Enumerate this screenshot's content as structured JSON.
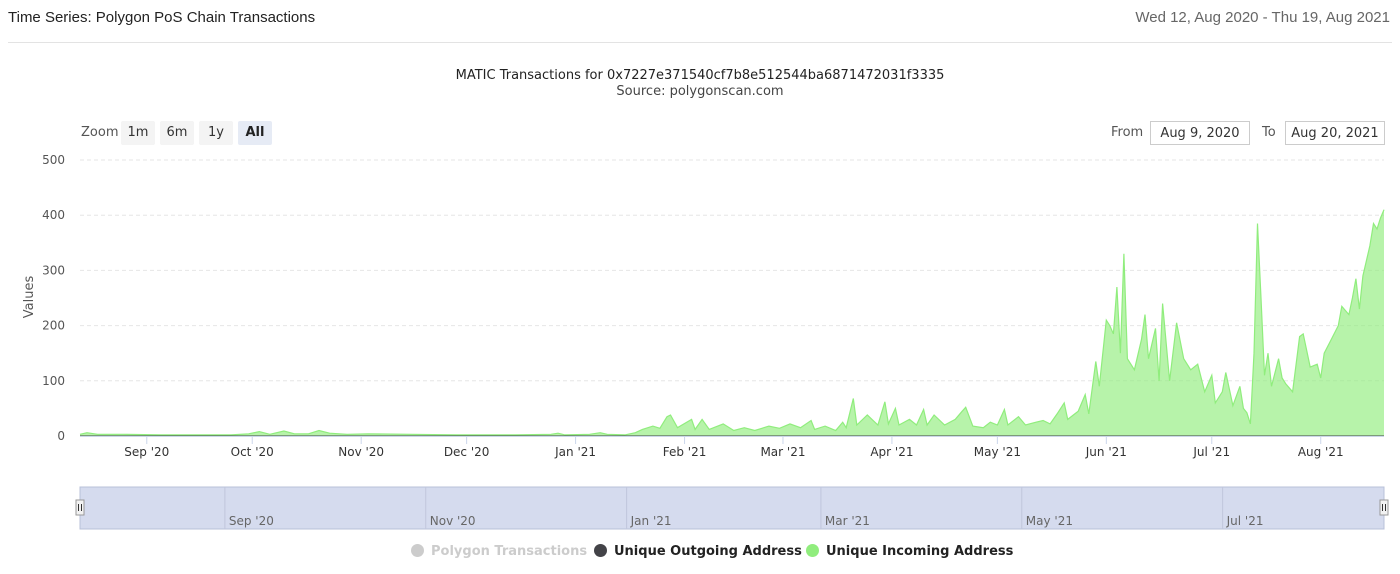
{
  "header": {
    "title": "Time Series: Polygon PoS Chain Transactions",
    "date_range": "Wed 12, Aug 2020 - Thu 19, Aug 2021"
  },
  "zoom": {
    "label": "Zoom",
    "buttons": [
      {
        "label": "1m",
        "active": false
      },
      {
        "label": "6m",
        "active": false
      },
      {
        "label": "1y",
        "active": false
      },
      {
        "label": "All",
        "active": true
      }
    ]
  },
  "range": {
    "from_label": "From",
    "from_value": "Aug 9, 2020",
    "to_label": "To",
    "to_value": "Aug 20, 2021"
  },
  "navigator": {
    "labels": [
      "Sep '20",
      "Nov '20",
      "Jan '21",
      "Mar '21",
      "May '21",
      "Jul '21"
    ]
  },
  "legend": [
    {
      "name": "Polygon Transactions",
      "color": "#cccccc",
      "visible": false
    },
    {
      "name": "Unique Outgoing Address",
      "color": "#434348",
      "visible": true
    },
    {
      "name": "Unique Incoming Address",
      "color": "#90ed7d",
      "visible": true
    }
  ],
  "chart_data": {
    "type": "area",
    "title": "MATIC Transactions for 0x7227e371540cf7b8e512544ba6871472031f3335",
    "subtitle": "Source: polygonscan.com",
    "ylabel": "Values",
    "ylim": [
      0,
      500
    ],
    "yticks": [
      0,
      100,
      200,
      300,
      400,
      500
    ],
    "xlim": [
      "2020-08-13",
      "2021-08-19"
    ],
    "xticks": [
      {
        "date": "2020-09-01",
        "label": "Sep '20"
      },
      {
        "date": "2020-10-01",
        "label": "Oct '20"
      },
      {
        "date": "2020-11-01",
        "label": "Nov '20"
      },
      {
        "date": "2020-12-01",
        "label": "Dec '20"
      },
      {
        "date": "2021-01-01",
        "label": "Jan '21"
      },
      {
        "date": "2021-02-01",
        "label": "Feb '21"
      },
      {
        "date": "2021-03-01",
        "label": "Mar '21"
      },
      {
        "date": "2021-04-01",
        "label": "Apr '21"
      },
      {
        "date": "2021-05-01",
        "label": "May '21"
      },
      {
        "date": "2021-06-01",
        "label": "Jun '21"
      },
      {
        "date": "2021-07-01",
        "label": "Jul '21"
      },
      {
        "date": "2021-08-01",
        "label": "Aug '21"
      }
    ],
    "grid": true,
    "legend_position": "bottom",
    "series": [
      {
        "name": "Unique Incoming Address",
        "color": "#90ed7d",
        "points": [
          [
            "2020-08-13",
            3
          ],
          [
            "2020-08-15",
            6
          ],
          [
            "2020-08-18",
            3
          ],
          [
            "2020-08-25",
            3
          ],
          [
            "2020-09-05",
            2
          ],
          [
            "2020-09-15",
            2
          ],
          [
            "2020-09-25",
            2
          ],
          [
            "2020-09-30",
            4
          ],
          [
            "2020-10-03",
            8
          ],
          [
            "2020-10-06",
            3
          ],
          [
            "2020-10-10",
            9
          ],
          [
            "2020-10-13",
            4
          ],
          [
            "2020-10-17",
            4
          ],
          [
            "2020-10-20",
            10
          ],
          [
            "2020-10-23",
            5
          ],
          [
            "2020-10-28",
            3
          ],
          [
            "2020-11-03",
            4
          ],
          [
            "2020-11-15",
            3
          ],
          [
            "2020-11-28",
            2
          ],
          [
            "2020-12-15",
            2
          ],
          [
            "2020-12-25",
            3
          ],
          [
            "2020-12-27",
            5
          ],
          [
            "2020-12-29",
            2
          ],
          [
            "2021-01-05",
            3
          ],
          [
            "2021-01-08",
            6
          ],
          [
            "2021-01-10",
            3
          ],
          [
            "2021-01-15",
            2
          ],
          [
            "2021-01-18",
            6
          ],
          [
            "2021-01-20",
            12
          ],
          [
            "2021-01-23",
            18
          ],
          [
            "2021-01-25",
            14
          ],
          [
            "2021-01-27",
            35
          ],
          [
            "2021-01-28",
            38
          ],
          [
            "2021-01-30",
            15
          ],
          [
            "2021-02-03",
            30
          ],
          [
            "2021-02-04",
            12
          ],
          [
            "2021-02-06",
            30
          ],
          [
            "2021-02-08",
            12
          ],
          [
            "2021-02-12",
            22
          ],
          [
            "2021-02-15",
            10
          ],
          [
            "2021-02-18",
            15
          ],
          [
            "2021-02-21",
            10
          ],
          [
            "2021-02-25",
            18
          ],
          [
            "2021-02-28",
            14
          ],
          [
            "2021-03-03",
            22
          ],
          [
            "2021-03-06",
            15
          ],
          [
            "2021-03-09",
            28
          ],
          [
            "2021-03-10",
            12
          ],
          [
            "2021-03-13",
            18
          ],
          [
            "2021-03-16",
            10
          ],
          [
            "2021-03-18",
            25
          ],
          [
            "2021-03-19",
            15
          ],
          [
            "2021-03-21",
            68
          ],
          [
            "2021-03-22",
            20
          ],
          [
            "2021-03-25",
            38
          ],
          [
            "2021-03-28",
            20
          ],
          [
            "2021-03-30",
            62
          ],
          [
            "2021-03-31",
            22
          ],
          [
            "2021-04-02",
            50
          ],
          [
            "2021-04-03",
            20
          ],
          [
            "2021-04-06",
            30
          ],
          [
            "2021-04-08",
            20
          ],
          [
            "2021-04-10",
            48
          ],
          [
            "2021-04-11",
            20
          ],
          [
            "2021-04-13",
            38
          ],
          [
            "2021-04-16",
            20
          ],
          [
            "2021-04-19",
            30
          ],
          [
            "2021-04-21",
            45
          ],
          [
            "2021-04-22",
            52
          ],
          [
            "2021-04-24",
            18
          ],
          [
            "2021-04-27",
            15
          ],
          [
            "2021-04-29",
            25
          ],
          [
            "2021-05-01",
            20
          ],
          [
            "2021-05-03",
            48
          ],
          [
            "2021-05-04",
            20
          ],
          [
            "2021-05-07",
            35
          ],
          [
            "2021-05-09",
            20
          ],
          [
            "2021-05-12",
            25
          ],
          [
            "2021-05-14",
            28
          ],
          [
            "2021-05-16",
            22
          ],
          [
            "2021-05-18",
            40
          ],
          [
            "2021-05-20",
            60
          ],
          [
            "2021-05-21",
            30
          ],
          [
            "2021-05-24",
            45
          ],
          [
            "2021-05-26",
            75
          ],
          [
            "2021-05-27",
            40
          ],
          [
            "2021-05-29",
            135
          ],
          [
            "2021-05-30",
            90
          ],
          [
            "2021-06-01",
            210
          ],
          [
            "2021-06-02",
            200
          ],
          [
            "2021-06-03",
            185
          ],
          [
            "2021-06-04",
            270
          ],
          [
            "2021-06-05",
            150
          ],
          [
            "2021-06-06",
            330
          ],
          [
            "2021-06-07",
            140
          ],
          [
            "2021-06-09",
            120
          ],
          [
            "2021-06-11",
            175
          ],
          [
            "2021-06-12",
            220
          ],
          [
            "2021-06-13",
            140
          ],
          [
            "2021-06-15",
            195
          ],
          [
            "2021-06-16",
            100
          ],
          [
            "2021-06-17",
            240
          ],
          [
            "2021-06-19",
            100
          ],
          [
            "2021-06-21",
            205
          ],
          [
            "2021-06-23",
            140
          ],
          [
            "2021-06-25",
            120
          ],
          [
            "2021-06-27",
            130
          ],
          [
            "2021-06-29",
            80
          ],
          [
            "2021-07-01",
            110
          ],
          [
            "2021-07-02",
            60
          ],
          [
            "2021-07-04",
            80
          ],
          [
            "2021-07-05",
            115
          ],
          [
            "2021-07-07",
            55
          ],
          [
            "2021-07-09",
            90
          ],
          [
            "2021-07-10",
            50
          ],
          [
            "2021-07-11",
            42
          ],
          [
            "2021-07-12",
            22
          ],
          [
            "2021-07-13",
            150
          ],
          [
            "2021-07-14",
            385
          ],
          [
            "2021-07-15",
            250
          ],
          [
            "2021-07-16",
            110
          ],
          [
            "2021-07-17",
            150
          ],
          [
            "2021-07-18",
            90
          ],
          [
            "2021-07-20",
            140
          ],
          [
            "2021-07-21",
            105
          ],
          [
            "2021-07-22",
            95
          ],
          [
            "2021-07-24",
            80
          ],
          [
            "2021-07-26",
            180
          ],
          [
            "2021-07-27",
            185
          ],
          [
            "2021-07-29",
            125
          ],
          [
            "2021-07-31",
            130
          ],
          [
            "2021-08-01",
            105
          ],
          [
            "2021-08-02",
            150
          ],
          [
            "2021-08-04",
            175
          ],
          [
            "2021-08-06",
            200
          ],
          [
            "2021-08-07",
            235
          ],
          [
            "2021-08-09",
            220
          ],
          [
            "2021-08-10",
            250
          ],
          [
            "2021-08-11",
            285
          ],
          [
            "2021-08-12",
            230
          ],
          [
            "2021-08-13",
            290
          ],
          [
            "2021-08-15",
            345
          ],
          [
            "2021-08-16",
            385
          ],
          [
            "2021-08-17",
            375
          ],
          [
            "2021-08-18",
            395
          ],
          [
            "2021-08-19",
            410
          ]
        ]
      },
      {
        "name": "Unique Outgoing Address",
        "color": "#434348",
        "points": [
          [
            "2020-08-13",
            0
          ],
          [
            "2021-08-19",
            0
          ]
        ]
      }
    ]
  }
}
